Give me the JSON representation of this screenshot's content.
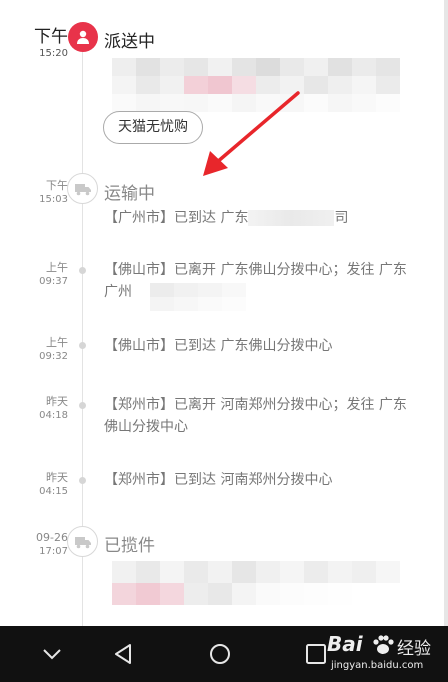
{
  "header": {
    "time_top": "下午",
    "time_bottom": "15:20",
    "status": "派送中",
    "tag_label": "天猫无忧购"
  },
  "entries": [
    {
      "time_top": "下午",
      "time_bottom": "15:03",
      "status": "运输中",
      "text": "【广州市】已到达 广东",
      "text_tail": "司"
    },
    {
      "time_top": "上午",
      "time_bottom": "09:37",
      "text": "【佛山市】已离开 广东佛山分拨中心；发往 广东广州"
    },
    {
      "time_top": "上午",
      "time_bottom": "09:32",
      "text": "【佛山市】已到达 广东佛山分拨中心"
    },
    {
      "time_top": "昨天",
      "time_bottom": "04:18",
      "text": "【郑州市】已离开 河南郑州分拨中心；发往 广东佛山分拨中心"
    },
    {
      "time_top": "昨天",
      "time_bottom": "04:15",
      "text": "【郑州市】已到达 河南郑州分拨中心"
    },
    {
      "time_top": "09-26",
      "time_bottom": "17:07",
      "status": "已揽件"
    }
  ],
  "watermark": {
    "brand": "Bai",
    "brand_suffix": "经验",
    "url": "jingyan.baidu.com"
  },
  "colors": {
    "accent": "#e8334a",
    "arrow": "#e8262b",
    "navbar": "#111111"
  },
  "icons": {
    "header_node": "person-icon",
    "transit_node": "truck-icon",
    "pickup_node": "truck-icon",
    "nav_back": "back-icon",
    "nav_home": "home-icon",
    "nav_recent": "recent-apps-icon",
    "nav_down": "chevron-down-icon"
  }
}
